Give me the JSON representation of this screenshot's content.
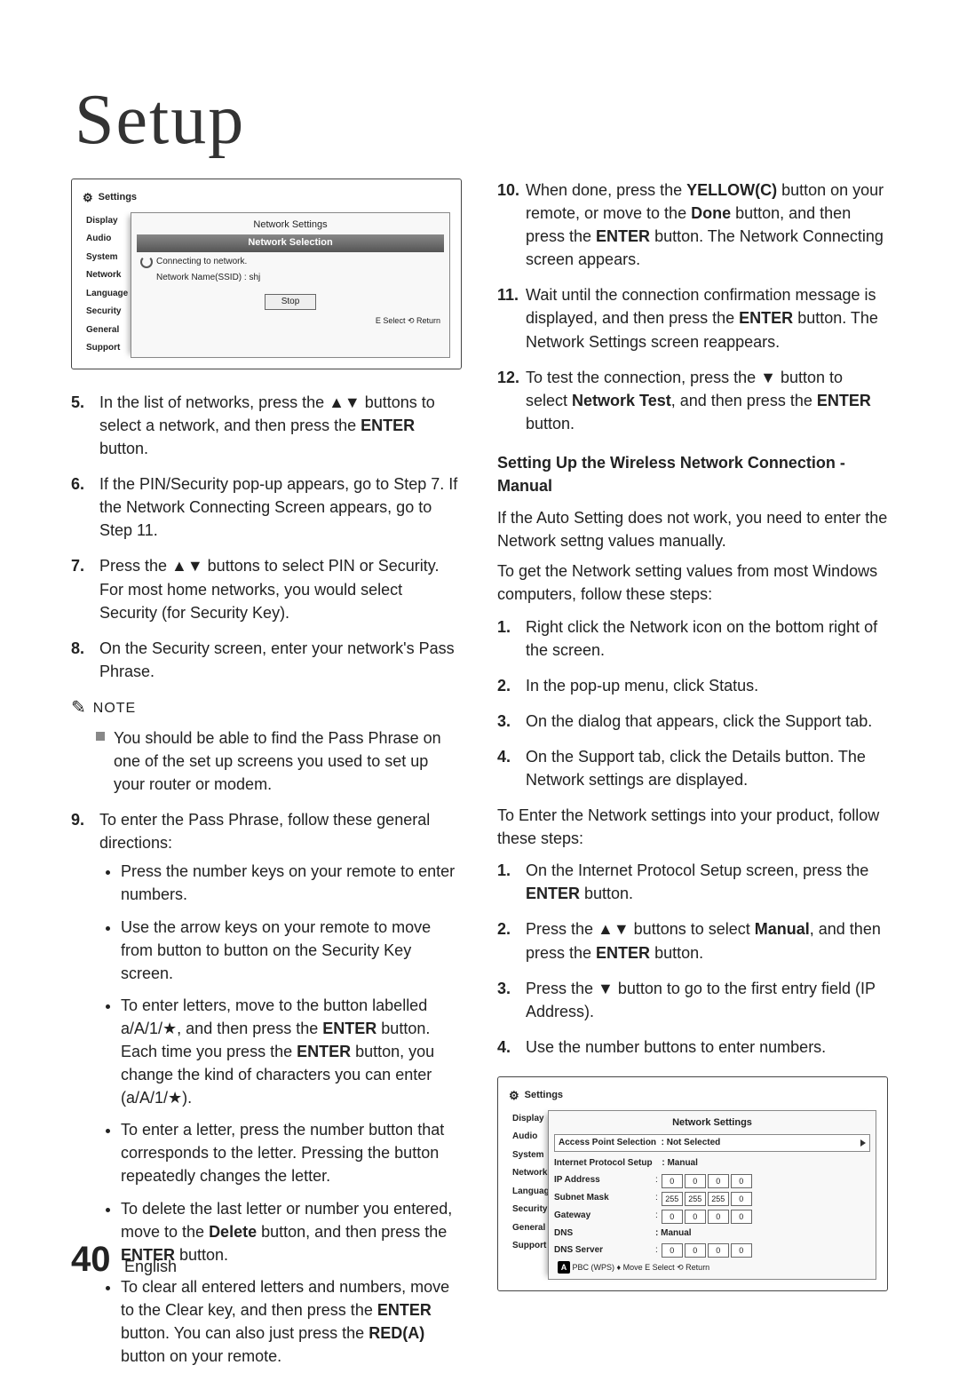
{
  "title": "Setup",
  "page_number": "40",
  "language": "English",
  "screenshot1": {
    "header_icon": "⚙",
    "header": "Settings",
    "sidebar": [
      "Display",
      "Audio",
      "System",
      "Network",
      "Language",
      "Security",
      "General",
      "Support"
    ],
    "panel_title": "Network Settings",
    "panel_subtitle": "Network Selection",
    "line1": "Connecting to network.",
    "line2": "Network Name(SSID) : shj",
    "stop": "Stop",
    "footer": "E Select   ⟲ Return"
  },
  "left_steps": {
    "s5": {
      "n": "5.",
      "t": "In the list of networks, press the ▲▼ buttons to select a network, and then press the ENTER button."
    },
    "s6": {
      "n": "6.",
      "t": "If the PIN/Security pop-up appears, go to Step 7. If the Network Connecting Screen appears, go to Step 11."
    },
    "s7": {
      "n": "7.",
      "t": "Press the ▲▼ buttons to select PIN or Security.\nFor most home networks, you would select Security (for Security Key)."
    },
    "s8": {
      "n": "8.",
      "t": "On the Security screen, enter your network's Pass Phrase."
    }
  },
  "note": {
    "label": "NOTE",
    "text": "You should be able to find the Pass Phrase on one of the set up screens you used to set up your router or modem."
  },
  "step9": {
    "n": "9.",
    "intro": "To enter the Pass Phrase, follow these general directions:",
    "bullets": [
      "Press the number keys on your remote to enter numbers.",
      "Use the arrow keys on your remote to move from button to button on the Security Key screen.",
      "To enter letters, move to the button labelled a/A/1/★, and then press the ENTER button. Each time you press the ENTER button, you change the kind of characters you can enter (a/A/1/★).",
      "To enter a letter, press the number button that corresponds to the letter. Pressing the button repeatedly changes the letter.",
      "To delete the last letter or number you entered, move to the Delete button, and then press the ENTER button.",
      "To clear all entered letters and numbers, move to the Clear key, and then press the ENTER button. You can also just press the RED(A) button on your remote."
    ]
  },
  "right_steps_top": {
    "s10": {
      "n": "10.",
      "t": "When done, press the YELLOW(C) button on your remote, or move to the Done button, and then press the ENTER button. The Network Connecting screen appears."
    },
    "s11": {
      "n": "11.",
      "t": "Wait until the connection confirmation message is displayed, and then press the ENTER button. The Network Settings screen reappears."
    },
    "s12": {
      "n": "12.",
      "t": "To test the connection, press the ▼ button to select Network Test, and then press the ENTER button."
    }
  },
  "section_heading": "Setting Up the Wireless Network Connection - Manual",
  "para1": "If the Auto Setting does not work, you need to enter the Network settng values manually.",
  "para2": "To get the Network setting values from most Windows computers, follow these steps:",
  "right_list1": {
    "s1": {
      "n": "1.",
      "t": "Right click the Network icon on the bottom right of the screen."
    },
    "s2": {
      "n": "2.",
      "t": "In the pop-up menu, click Status."
    },
    "s3": {
      "n": "3.",
      "t": "On the dialog that appears, click the Support tab."
    },
    "s4": {
      "n": "4.",
      "t": "On the Support tab, click the Details button. The Network settings are displayed."
    }
  },
  "para3": "To Enter the Network settings into your product, follow these steps:",
  "right_list2": {
    "s1": {
      "n": "1.",
      "t": "On the Internet Protocol Setup screen, press the ENTER button."
    },
    "s2": {
      "n": "2.",
      "t": "Press the ▲▼ buttons to select Manual, and then press the ENTER button."
    },
    "s3": {
      "n": "3.",
      "t": "Press the ▼ button to go to the first entry field (IP Address)."
    },
    "s4": {
      "n": "4.",
      "t": "Use the number buttons to enter numbers."
    }
  },
  "screenshot2": {
    "header_icon": "⚙",
    "header": "Settings",
    "sidebar": [
      "Display",
      "Audio",
      "System",
      "Network",
      "Language",
      "Security",
      "General",
      "Support"
    ],
    "panel_title": "Network Settings",
    "ap_label": "Access Point Selection",
    "ap_value": ": Not Selected",
    "ips_label": "Internet Protocol Setup",
    "ips_value": ": Manual",
    "rows": [
      {
        "label": "IP Address",
        "vals": [
          "0",
          "0",
          "0",
          "0"
        ]
      },
      {
        "label": "Subnet Mask",
        "vals": [
          "255",
          "255",
          "255",
          "0"
        ]
      },
      {
        "label": "Gateway",
        "vals": [
          "0",
          "0",
          "0",
          "0"
        ]
      }
    ],
    "dns_label": "DNS",
    "dns_value": ": Manual",
    "dns_server_label": "DNS Server",
    "dns_server_vals": [
      "0",
      "0",
      "0",
      "0"
    ],
    "footer_a": "A",
    "footer": "PBC (WPS)   ♦ Move   E Select   ⟲ Return"
  }
}
